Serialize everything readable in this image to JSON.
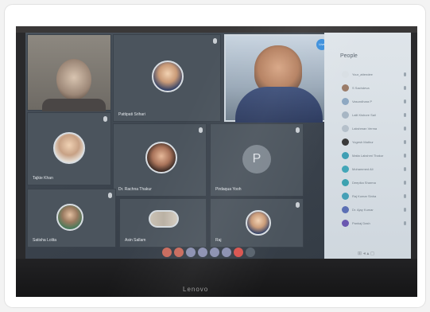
{
  "screen": {
    "brand": "Lenovo",
    "participants": [
      {
        "id": "self",
        "name": "",
        "type": "self-video"
      },
      {
        "id": "p2",
        "name": "Pattipati Srihari",
        "type": "avatar",
        "avatar": "face"
      },
      {
        "id": "p3",
        "name": "",
        "type": "camera",
        "badge": "Live"
      },
      {
        "id": "p4",
        "name": "Tajkie Khan",
        "type": "avatar",
        "avatar": "light"
      },
      {
        "id": "p5",
        "name": "Dr. Rachna Thakur",
        "type": "avatar",
        "avatar": "female"
      },
      {
        "id": "p6",
        "name": "Pirdaqua Yooh",
        "type": "initial",
        "initial": "P"
      },
      {
        "id": "p7",
        "name": "Satisha Lolita",
        "type": "avatar",
        "avatar": "green"
      },
      {
        "id": "p8",
        "name": "Asin Sallam",
        "type": "group-avatar"
      },
      {
        "id": "p9",
        "name": "Raj",
        "type": "avatar",
        "avatar": "face"
      }
    ],
    "people_panel": {
      "title": "People",
      "items": [
        {
          "name": "Your_attendee",
          "color": "#d9dfe4"
        },
        {
          "name": "S Sachdeva",
          "color": "#9a7b68"
        },
        {
          "name": "Vasundhara P",
          "color": "#8ea8c2"
        },
        {
          "name": "Lalit Kishore Sail",
          "color": "#a7b6c4"
        },
        {
          "name": "Lakshman Verma",
          "color": "#b5c0ca"
        },
        {
          "name": "Yogesh Mathur",
          "color": "#3a3a3a"
        },
        {
          "name": "Matia Lakshmi Thakur",
          "color": "#3f9fb4"
        },
        {
          "name": "Mohammed Ali",
          "color": "#43a6b8"
        },
        {
          "name": "Deepika Sharma",
          "color": "#3ca2b0"
        },
        {
          "name": "Raj Kumar Sinha",
          "color": "#46a0b6"
        },
        {
          "name": "Dr. Ajay Kumar",
          "color": "#5b6fb4"
        },
        {
          "name": "Pankaj Dash",
          "color": "#6a57b0"
        }
      ]
    },
    "status_text": "",
    "controls": [
      {
        "name": "video-button",
        "color": "#c96a5c"
      },
      {
        "name": "mic-button",
        "color": "#c96a5c"
      },
      {
        "name": "share-button",
        "color": "#8a8fb0"
      },
      {
        "name": "chat-button",
        "color": "#8a8fb0"
      },
      {
        "name": "people-button",
        "color": "#8a8fb0"
      },
      {
        "name": "more-button",
        "color": "#8a8fb0"
      },
      {
        "name": "end-call-button",
        "color": "#d9544f"
      },
      {
        "name": "settings-button",
        "color": "#59636e"
      }
    ],
    "system_tray": "⊞ ◂ ▴ ◻"
  }
}
